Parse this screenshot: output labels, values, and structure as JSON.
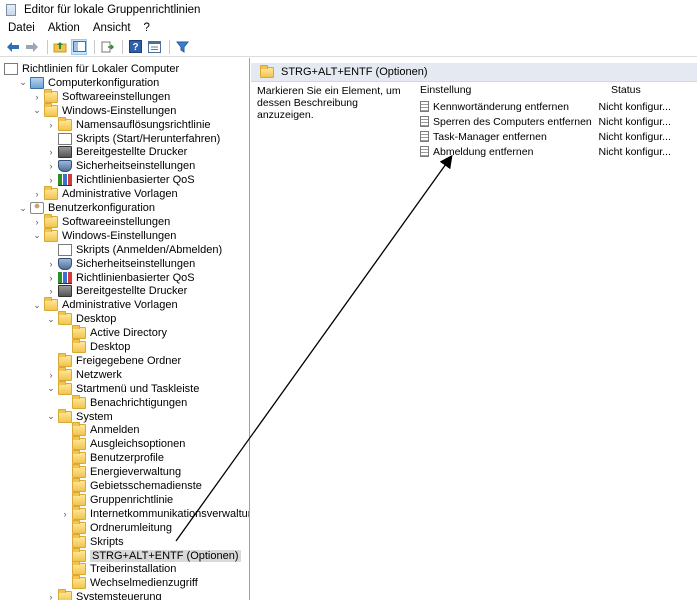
{
  "window": {
    "title": "Editor für lokale Gruppenrichtlinien"
  },
  "menu": {
    "items": [
      "Datei",
      "Aktion",
      "Ansicht",
      "?"
    ]
  },
  "toolbar": {
    "icons": [
      "back-arrow-icon",
      "forward-arrow-icon",
      "up-folder-icon",
      "show-hide-tree-icon",
      "export-list-icon",
      "help-icon",
      "properties-icon",
      "filter-icon"
    ]
  },
  "tree": {
    "items": [
      {
        "label": "Richtlinien für Lokaler Computer",
        "level": 0,
        "icon": "root",
        "chevron": ""
      },
      {
        "label": "Computerkonfiguration",
        "level": 1,
        "icon": "computer",
        "chevron": "open"
      },
      {
        "label": "Softwareeinstellungen",
        "level": 2,
        "icon": "folder",
        "chevron": "closed"
      },
      {
        "label": "Windows-Einstellungen",
        "level": 2,
        "icon": "folder",
        "chevron": "open"
      },
      {
        "label": "Namensauflösungsrichtlinie",
        "level": 3,
        "icon": "folder",
        "chevron": "closed"
      },
      {
        "label": "Skripts (Start/Herunterfahren)",
        "level": 3,
        "icon": "policy",
        "chevron": ""
      },
      {
        "label": "Bereitgestellte Drucker",
        "level": 3,
        "icon": "printer",
        "chevron": "closed"
      },
      {
        "label": "Sicherheitseinstellungen",
        "level": 3,
        "icon": "shield",
        "chevron": "closed"
      },
      {
        "label": "Richtlinienbasierter QoS",
        "level": 3,
        "icon": "chart",
        "chevron": "closed"
      },
      {
        "label": "Administrative Vorlagen",
        "level": 2,
        "icon": "folder",
        "chevron": "closed"
      },
      {
        "label": "Benutzerkonfiguration",
        "level": 1,
        "icon": "user",
        "chevron": "open"
      },
      {
        "label": "Softwareeinstellungen",
        "level": 2,
        "icon": "folder",
        "chevron": "closed"
      },
      {
        "label": "Windows-Einstellungen",
        "level": 2,
        "icon": "folder",
        "chevron": "open"
      },
      {
        "label": "Skripts (Anmelden/Abmelden)",
        "level": 3,
        "icon": "policy",
        "chevron": ""
      },
      {
        "label": "Sicherheitseinstellungen",
        "level": 3,
        "icon": "shield",
        "chevron": "closed"
      },
      {
        "label": "Richtlinienbasierter QoS",
        "level": 3,
        "icon": "chart",
        "chevron": "closed"
      },
      {
        "label": "Bereitgestellte Drucker",
        "level": 3,
        "icon": "printer",
        "chevron": "closed"
      },
      {
        "label": "Administrative Vorlagen",
        "level": 2,
        "icon": "folder",
        "chevron": "open"
      },
      {
        "label": "Desktop",
        "level": 3,
        "icon": "folder",
        "chevron": "open"
      },
      {
        "label": "Active Directory",
        "level": 4,
        "icon": "folder",
        "chevron": ""
      },
      {
        "label": "Desktop",
        "level": 4,
        "icon": "folder",
        "chevron": ""
      },
      {
        "label": "Freigegebene Ordner",
        "level": 3,
        "icon": "folder",
        "chevron": ""
      },
      {
        "label": "Netzwerk",
        "level": 3,
        "icon": "folder",
        "chevron": "closed"
      },
      {
        "label": "Startmenü und Taskleiste",
        "level": 3,
        "icon": "folder",
        "chevron": "open"
      },
      {
        "label": "Benachrichtigungen",
        "level": 4,
        "icon": "folder",
        "chevron": ""
      },
      {
        "label": "System",
        "level": 3,
        "icon": "folder",
        "chevron": "open"
      },
      {
        "label": "Anmelden",
        "level": 4,
        "icon": "folder",
        "chevron": ""
      },
      {
        "label": "Ausgleichsoptionen",
        "level": 4,
        "icon": "folder",
        "chevron": ""
      },
      {
        "label": "Benutzerprofile",
        "level": 4,
        "icon": "folder",
        "chevron": ""
      },
      {
        "label": "Energieverwaltung",
        "level": 4,
        "icon": "folder",
        "chevron": ""
      },
      {
        "label": "Gebietsschemadienste",
        "level": 4,
        "icon": "folder",
        "chevron": ""
      },
      {
        "label": "Gruppenrichtlinie",
        "level": 4,
        "icon": "folder",
        "chevron": ""
      },
      {
        "label": "Internetkommunikationsverwaltung",
        "level": 4,
        "icon": "folder",
        "chevron": "closed"
      },
      {
        "label": "Ordnerumleitung",
        "level": 4,
        "icon": "folder",
        "chevron": ""
      },
      {
        "label": "Skripts",
        "level": 4,
        "icon": "folder",
        "chevron": ""
      },
      {
        "label": "STRG+ALT+ENTF (Optionen)",
        "level": 4,
        "icon": "folder",
        "chevron": "",
        "selected": true
      },
      {
        "label": "Treiberinstallation",
        "level": 4,
        "icon": "folder",
        "chevron": ""
      },
      {
        "label": "Wechselmedienzugriff",
        "level": 4,
        "icon": "folder",
        "chevron": ""
      },
      {
        "label": "Systemsteuerung",
        "level": 3,
        "icon": "folder",
        "chevron": "closed"
      }
    ]
  },
  "details": {
    "header_title": "STRG+ALT+ENTF (Optionen)",
    "description": "Markieren Sie ein Element, um dessen Beschreibung anzuzeigen.",
    "columns": {
      "setting": "Einstellung",
      "status": "Status"
    },
    "rows": [
      {
        "name": "Kennwortänderung entfernen",
        "status": "Nicht konfigur..."
      },
      {
        "name": "Sperren des Computers entfernen",
        "status": "Nicht konfigur..."
      },
      {
        "name": "Task-Manager entfernen",
        "status": "Nicht konfigur..."
      },
      {
        "name": "Abmeldung entfernen",
        "status": "Nicht konfigur..."
      }
    ]
  },
  "colors": {
    "header_band": "#e5eaf2",
    "selection": "#d9d9d9",
    "folder": "#f2c44f",
    "accent": "#2f6fb8"
  }
}
